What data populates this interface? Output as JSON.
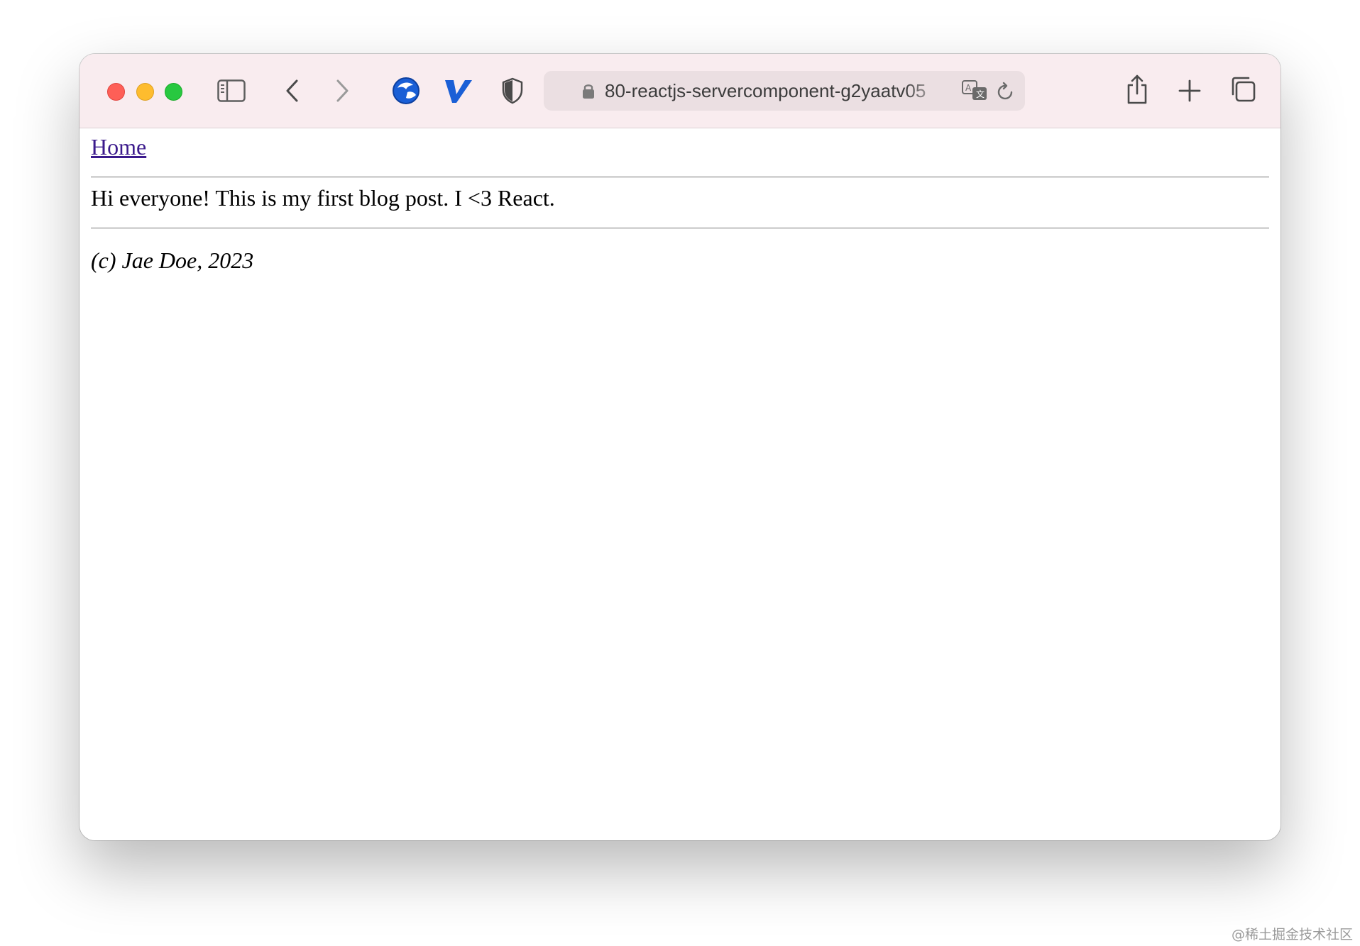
{
  "browser": {
    "url": "80-reactjs-servercomponent-g2yaatv05",
    "icons": {
      "sidebar": "sidebar-icon",
      "back": "chevron-left-icon",
      "forward": "chevron-right-icon",
      "extension_1": "globe-extension-icon",
      "extension_2": "v-extension-icon",
      "extension_3": "shield-icon",
      "lock": "lock-icon",
      "translate": "translate-icon",
      "reload": "reload-icon",
      "share": "share-icon",
      "new_tab": "plus-icon",
      "tabs": "tab-overview-icon"
    },
    "colors": {
      "toolbar_bg": "#f9ecef",
      "urlbar_bg": "#ebdfe2",
      "close": "#fe5f57",
      "minimize": "#febc2e",
      "zoom": "#28c840",
      "extension_blue": "#1a5fd6"
    }
  },
  "page": {
    "nav_link": "Home",
    "post_body": "Hi everyone! This is my first blog post. I <3 React.",
    "footer": "(c) Jae Doe, 2023"
  },
  "watermark": "@稀土掘金技术社区"
}
